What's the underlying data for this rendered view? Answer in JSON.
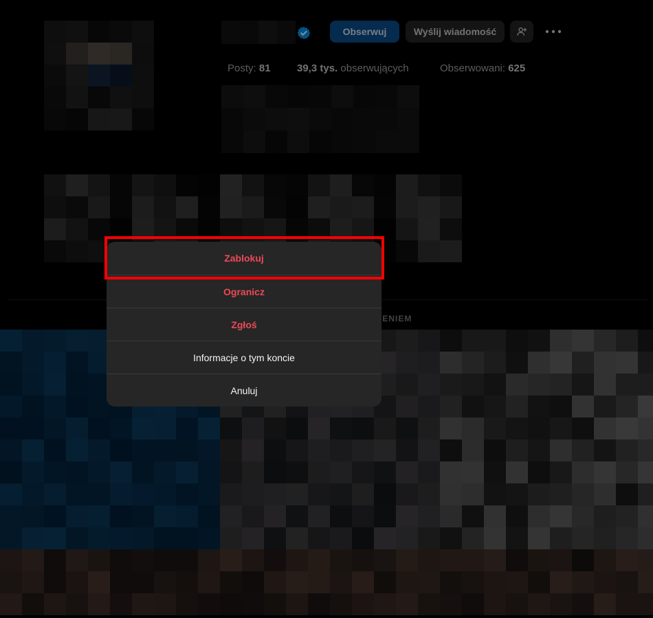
{
  "header": {
    "follow_label": "Obserwuj",
    "message_label": "Wyślij wiadomość",
    "suggest_icon": "person-plus-icon",
    "more_icon": "ellipsis-icon",
    "verified_icon": "verified-badge-icon"
  },
  "stats": {
    "posts_label": "Posty:",
    "posts_value": "81",
    "followers_value": "39,3 tys.",
    "followers_label": "obserwujących",
    "following_label": "Obserwowani:",
    "following_value": "625"
  },
  "tabs": {
    "partial_label": "ZENIEM"
  },
  "dialog": {
    "items": [
      {
        "label": "Zablokuj",
        "style": "danger"
      },
      {
        "label": "Ogranicz",
        "style": "danger"
      },
      {
        "label": "Zgłoś",
        "style": "danger"
      },
      {
        "label": "Informacje o tym koncie",
        "style": "normal"
      },
      {
        "label": "Anuluj",
        "style": "normal"
      }
    ]
  },
  "colors": {
    "accent": "#0095f6",
    "danger": "#ed4956",
    "highlight": "#ff0000",
    "dialog_bg": "#262626"
  }
}
